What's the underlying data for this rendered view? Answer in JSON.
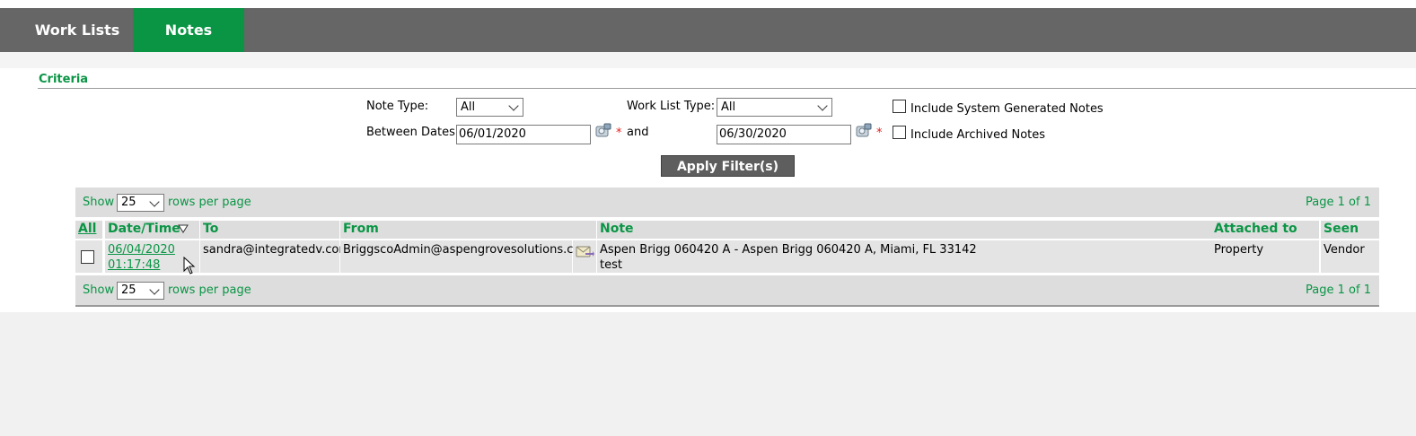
{
  "tabs": [
    {
      "label": "Work Lists",
      "active": false
    },
    {
      "label": "Notes",
      "active": true
    }
  ],
  "criteria": {
    "title": "Criteria",
    "note_type_label": "Note Type:",
    "note_type_value": "All",
    "work_list_type_label": "Work List Type:",
    "work_list_type_value": "All",
    "between_dates_label": "Between Dates:",
    "start_date": "06/01/2020",
    "and_label": "and",
    "end_date": "06/30/2020",
    "required_mark": "*",
    "include_system_label": "Include System Generated Notes",
    "include_system_checked": false,
    "include_archived_label": "Include Archived Notes",
    "include_archived_checked": false,
    "apply_button": "Apply Filter(s)"
  },
  "pager_top": {
    "show": "Show",
    "rows_value": "25",
    "rows_per_page": "rows per page",
    "page_info": "Page 1 of 1"
  },
  "pager_bottom": {
    "show": "Show",
    "rows_value": "25",
    "rows_per_page": "rows per page",
    "page_info": "Page 1 of 1"
  },
  "table": {
    "columns": {
      "all": "All",
      "datetime": "Date/Time",
      "to": "To",
      "from": "From",
      "note": "Note",
      "attached_to": "Attached to",
      "seen_by": "Seen By"
    },
    "rows": [
      {
        "checked": false,
        "date": "06/04/2020",
        "time": "01:17:48",
        "to": "sandra@integratedv.com",
        "from": "BriggscoAdmin@aspengrovesolutions.com",
        "note_line1": "Aspen Brigg 060420 A - Aspen Brigg 060420 A, Miami, FL 33142",
        "note_line2": "test",
        "attached_to": "Property",
        "seen_by": "Vendor"
      }
    ]
  },
  "colors": {
    "accent": "#0a9545",
    "tabbar": "#666666",
    "button": "#5e5e5e"
  }
}
